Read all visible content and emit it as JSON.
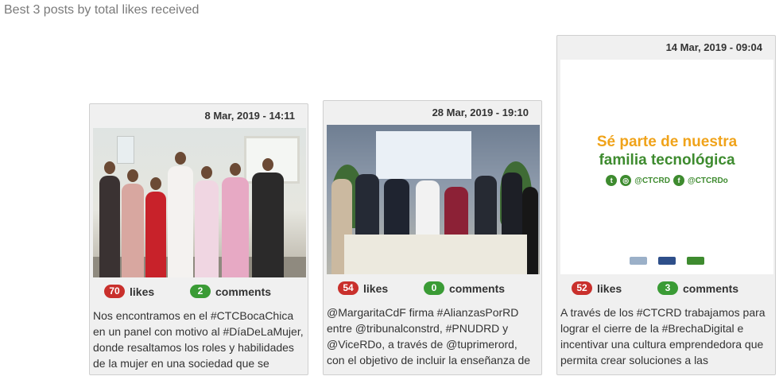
{
  "heading": "Best 3 posts by total likes received",
  "labels": {
    "likes": "likes",
    "comments": "comments"
  },
  "posts": [
    {
      "date": "8 Mar, 2019 - 14:11",
      "likes": "70",
      "comments": "2",
      "text": "Nos encontramos en el #CTCBocaChica en un panel con motivo al #DíaDeLaMujer, donde resaltamos los roles y habilidades de la mujer en una sociedad que se"
    },
    {
      "date": "28 Mar, 2019 - 19:10",
      "likes": "54",
      "comments": "0",
      "text": "@MargaritaCdF firma #AlianzasPorRD entre @tribunalconstrd, #PNUDRD y @ViceRDo, a través de @tuprimerord, con el objetivo de incluir la enseñanza de la"
    },
    {
      "date": "14 Mar, 2019 - 09:04",
      "likes": "52",
      "comments": "3",
      "text": "A través de los #CTCRD trabajamos para lograr el cierre de la #BrechaDigital e incentivar una cultura emprendedora que permita crear soluciones a las",
      "graphic": {
        "line1": "Sé parte de nuestra",
        "line2": "familia tecnológica",
        "handle1": "@CTCRD",
        "handle2": "@CTCRDo"
      }
    }
  ],
  "colors": {
    "likes_badge": "#c9302c",
    "comments_badge": "#3a9b35",
    "brand_orange": "#f0a31a",
    "brand_green": "#3e8b2f"
  }
}
